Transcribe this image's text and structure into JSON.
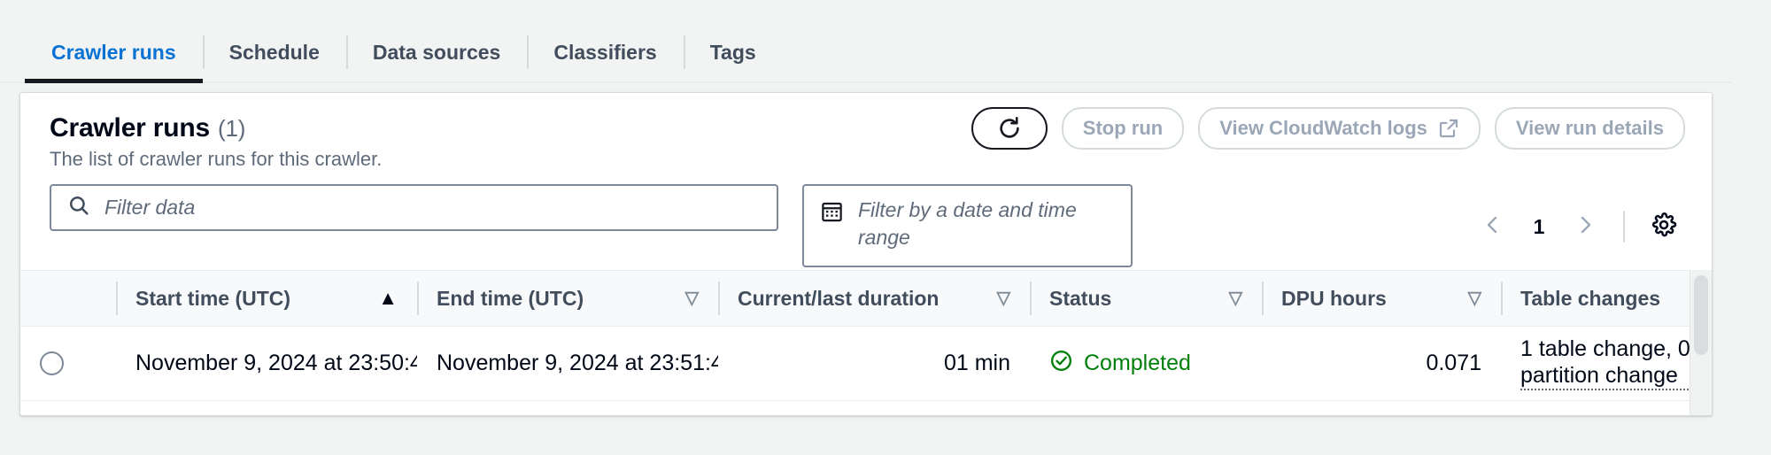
{
  "tabs": [
    {
      "label": "Crawler runs",
      "active": true
    },
    {
      "label": "Schedule",
      "active": false
    },
    {
      "label": "Data sources",
      "active": false
    },
    {
      "label": "Classifiers",
      "active": false
    },
    {
      "label": "Tags",
      "active": false
    }
  ],
  "panel": {
    "title": "Crawler runs",
    "count": "(1)",
    "description": "The list of crawler runs for this crawler."
  },
  "actions": {
    "refresh_icon": "refresh-icon",
    "stop_run": "Stop run",
    "view_logs": "View CloudWatch logs",
    "view_logs_icon": "external-link-icon",
    "view_details": "View run details"
  },
  "filters": {
    "search_placeholder": "Filter data",
    "search_value": "",
    "search_icon": "search-icon",
    "date_placeholder": "Filter by a date and time range",
    "date_icon": "calendar-icon"
  },
  "pagination": {
    "prev_icon": "chevron-left-icon",
    "page": "1",
    "next_icon": "chevron-right-icon",
    "settings_icon": "gear-icon"
  },
  "table": {
    "columns": [
      {
        "key": "select",
        "label": "",
        "sort": "none"
      },
      {
        "key": "start",
        "label": "Start time (UTC)",
        "sort": "asc"
      },
      {
        "key": "end",
        "label": "End time (UTC)",
        "sort": "sortable"
      },
      {
        "key": "duration",
        "label": "Current/last duration",
        "sort": "sortable",
        "align": "right"
      },
      {
        "key": "status",
        "label": "Status",
        "sort": "sortable"
      },
      {
        "key": "dpu",
        "label": "DPU hours",
        "sort": "sortable",
        "align": "right"
      },
      {
        "key": "changes",
        "label": "Table changes",
        "sort": "none"
      }
    ],
    "sort_asc_glyph": "▲",
    "sort_none_glyph": "▽",
    "rows": [
      {
        "selected": false,
        "start": "November 9, 2024 at 23:50:4",
        "end": "November 9, 2024 at 23:51:4",
        "duration": "01 min",
        "status": "Completed",
        "status_type": "success",
        "dpu": "0.071",
        "changes": "1 table change, 0 partition change"
      }
    ]
  },
  "colors": {
    "accent": "#0972d3",
    "success": "#037f0c",
    "text": "#000716",
    "muted": "#5f6b7a",
    "disabled": "#9ba7b6",
    "border": "#d5dbdb",
    "page_bg": "#f2f3f3"
  }
}
